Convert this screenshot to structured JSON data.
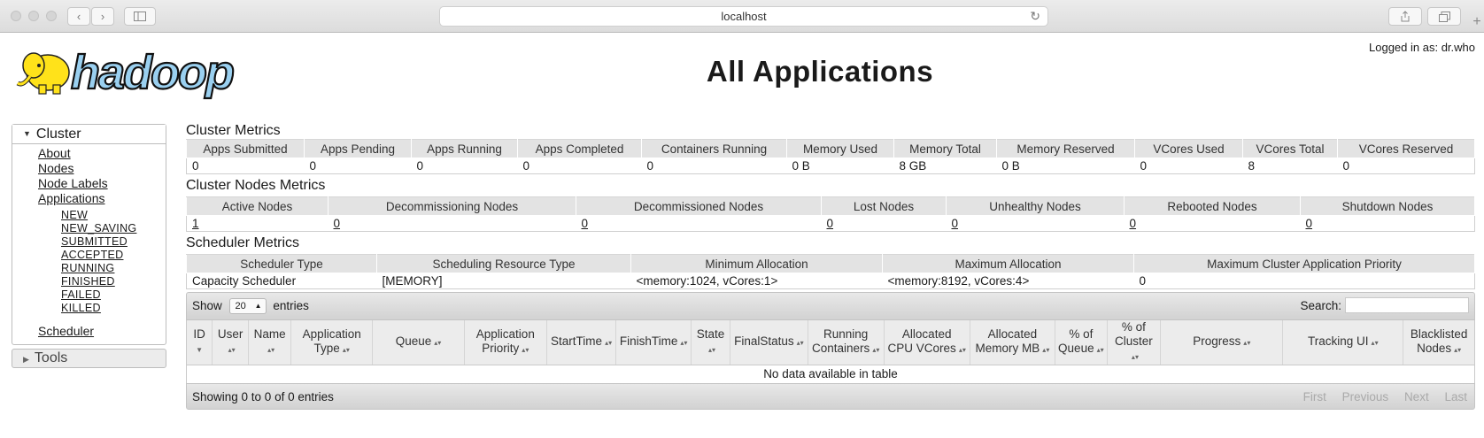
{
  "browser": {
    "address": "localhost"
  },
  "header": {
    "logo_text": "hadoop",
    "title": "All Applications",
    "logged_in": "Logged in as: dr.who"
  },
  "nav": {
    "cluster_label": "Cluster",
    "links": [
      "About",
      "Nodes",
      "Node Labels",
      "Applications"
    ],
    "app_states": [
      "NEW",
      "NEW_SAVING",
      "SUBMITTED",
      "ACCEPTED",
      "RUNNING",
      "FINISHED",
      "FAILED",
      "KILLED"
    ],
    "scheduler_label": "Scheduler",
    "tools_label": "Tools"
  },
  "cluster_metrics": {
    "title": "Cluster Metrics",
    "headers": [
      "Apps Submitted",
      "Apps Pending",
      "Apps Running",
      "Apps Completed",
      "Containers Running",
      "Memory Used",
      "Memory Total",
      "Memory Reserved",
      "VCores Used",
      "VCores Total",
      "VCores Reserved"
    ],
    "values": [
      "0",
      "0",
      "0",
      "0",
      "0",
      "0 B",
      "8 GB",
      "0 B",
      "0",
      "8",
      "0"
    ]
  },
  "node_metrics": {
    "title": "Cluster Nodes Metrics",
    "headers": [
      "Active Nodes",
      "Decommissioning Nodes",
      "Decommissioned Nodes",
      "Lost Nodes",
      "Unhealthy Nodes",
      "Rebooted Nodes",
      "Shutdown Nodes"
    ],
    "values": [
      "1",
      "0",
      "0",
      "0",
      "0",
      "0",
      "0"
    ]
  },
  "scheduler_metrics": {
    "title": "Scheduler Metrics",
    "headers": [
      "Scheduler Type",
      "Scheduling Resource Type",
      "Minimum Allocation",
      "Maximum Allocation",
      "Maximum Cluster Application Priority"
    ],
    "values": [
      "Capacity Scheduler",
      "[MEMORY]",
      "<memory:1024, vCores:1>",
      "<memory:8192, vCores:4>",
      "0"
    ]
  },
  "apps_table": {
    "show_label": "Show",
    "page_size": "20",
    "entries_label": "entries",
    "search_label": "Search:",
    "columns": [
      [
        "ID"
      ],
      [
        "User"
      ],
      [
        "Name"
      ],
      [
        "Application",
        "Type"
      ],
      [
        "Queue"
      ],
      [
        "Application",
        "Priority"
      ],
      [
        "StartTime"
      ],
      [
        "FinishTime"
      ],
      [
        "State"
      ],
      [
        "FinalStatus"
      ],
      [
        "Running",
        "Containers"
      ],
      [
        "Allocated",
        "CPU VCores"
      ],
      [
        "Allocated",
        "Memory MB"
      ],
      [
        "% of",
        "Queue"
      ],
      [
        "% of",
        "Cluster"
      ],
      [
        "Progress"
      ],
      [
        "Tracking UI"
      ],
      [
        "Blacklisted",
        "Nodes"
      ]
    ],
    "empty_message": "No data available in table",
    "info": "Showing 0 to 0 of 0 entries",
    "pager": [
      "First",
      "Previous",
      "Next",
      "Last"
    ]
  }
}
